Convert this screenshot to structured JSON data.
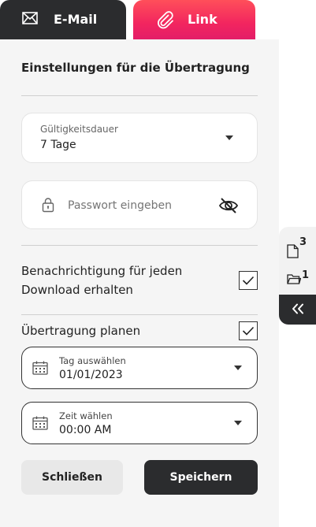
{
  "tabs": {
    "email_label": "E-Mail",
    "link_label": "Link"
  },
  "settings": {
    "title": "Einstellungen für die Übertragung",
    "validity": {
      "label": "Gültigkeitsdauer",
      "value": "7 Tage"
    },
    "password": {
      "placeholder": "Passwort eingeben"
    },
    "notify": {
      "line1": "Benachrichtigung für jeden",
      "line2": "Download erhalten",
      "checked": true
    },
    "schedule": {
      "label": "Übertragung planen",
      "checked": true
    },
    "day": {
      "label": "Tag auswählen",
      "value": "01/01/2023"
    },
    "time": {
      "label": "Zeit wählen",
      "value": "00:00 AM"
    },
    "close_label": "Schließen",
    "save_label": "Speichern"
  },
  "rail": {
    "files_count": "3",
    "folders_count": "1"
  },
  "colors": {
    "dark": "#2b2c2e",
    "accent_start": "#ff4f5a",
    "accent_end": "#e31d68",
    "panel": "#f5f5f5"
  }
}
